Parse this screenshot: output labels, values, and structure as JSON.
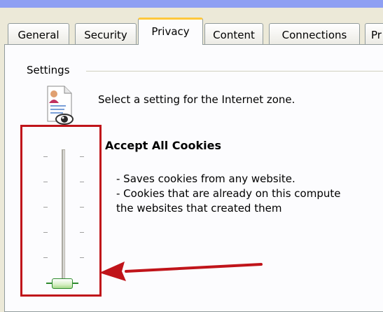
{
  "tabs": [
    {
      "label": "General",
      "active": false
    },
    {
      "label": "Security",
      "active": false
    },
    {
      "label": "Privacy",
      "active": true
    },
    {
      "label": "Content",
      "active": false
    },
    {
      "label": "Connections",
      "active": false
    },
    {
      "label": "Pr",
      "active": false
    }
  ],
  "settings": {
    "group_label": "Settings",
    "zone_text": "Select a setting for the Internet zone.",
    "level_title": "Accept All Cookies",
    "desc_line1": "- Saves cookies from any website.",
    "desc_line2": "- Cookies that are already on this compute",
    "desc_line3": "the websites that created them"
  },
  "slider": {
    "level": 0,
    "levels": 6
  },
  "colors": {
    "highlight_box": "#c0141a",
    "arrow": "#c0141a",
    "active_tab_accent": "#ffc83c",
    "title_bar": "#8e9ff3"
  },
  "icons": {
    "zone": "document-person-eye-icon"
  }
}
